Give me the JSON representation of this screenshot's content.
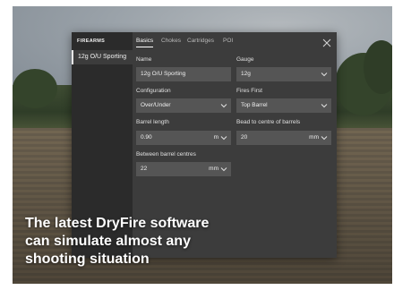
{
  "sidebar": {
    "header": "FIREARMS",
    "items": [
      {
        "label": "12g O/U Sporting"
      }
    ]
  },
  "tabs": [
    {
      "label": "Basics",
      "active": true
    },
    {
      "label": "Chokes",
      "active": false
    },
    {
      "label": "Cartridges",
      "active": false
    },
    {
      "label": "POI",
      "active": false
    }
  ],
  "form": {
    "name": {
      "label": "Name",
      "value": "12g O/U Sporting"
    },
    "gauge": {
      "label": "Gauge",
      "value": "12g"
    },
    "configuration": {
      "label": "Configuration",
      "value": "Over/Under"
    },
    "fires_first": {
      "label": "Fires First",
      "value": "Top Barrel"
    },
    "barrel_length": {
      "label": "Barrel length",
      "value": "0.90",
      "unit": "m"
    },
    "bead_to_centre": {
      "label": "Bead to centre of barrels",
      "value": "20",
      "unit": "mm"
    },
    "between_centres": {
      "label": "Between barrel centres",
      "value": "22",
      "unit": "mm"
    }
  },
  "caption": {
    "line1": "The latest DryFire software",
    "line2": "can simulate almost any",
    "line3": "shooting situation"
  },
  "colors": {
    "panel": "#3c3c3c",
    "sidebar": "#2b2b2b",
    "input": "#555555"
  }
}
